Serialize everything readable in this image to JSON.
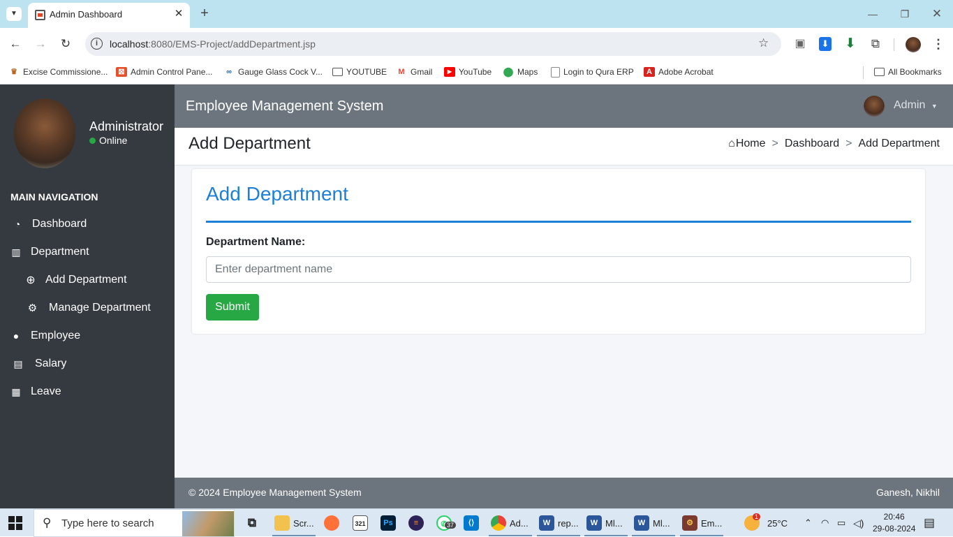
{
  "browser": {
    "tab_title": "Admin Dashboard",
    "url_host": "localhost",
    "url_path": ":8080/EMS-Project/addDepartment.jsp"
  },
  "bookmarks": {
    "items": [
      {
        "label": "Excise Commissione...",
        "icon": "emblem-icon",
        "color": "#b5651d"
      },
      {
        "label": "Admin Control Pane...",
        "icon": "admin-panel-icon",
        "color": "#e3522d"
      },
      {
        "label": "Gauge Glass Cock V...",
        "icon": "gauge-logo-icon",
        "color": "#1b5fbf"
      },
      {
        "label": "YOUTUBE",
        "icon": "folder-icon",
        "color": "#555555"
      },
      {
        "label": "Gmail",
        "icon": "gmail-icon",
        "color": "#ea4335"
      },
      {
        "label": "YouTube",
        "icon": "youtube-icon",
        "color": "#ff0000"
      },
      {
        "label": "Maps",
        "icon": "maps-pin-icon",
        "color": "#34a853"
      },
      {
        "label": "Login to Qura ERP",
        "icon": "page-icon",
        "color": "#777777"
      },
      {
        "label": "Adobe Acrobat",
        "icon": "acrobat-icon",
        "color": "#d8231f"
      }
    ],
    "all_bookmarks": "All Bookmarks"
  },
  "sidebar": {
    "user_name": "Administrator",
    "status": "Online",
    "nav_heading": "MAIN NAVIGATION",
    "items": [
      {
        "label": "Dashboard",
        "icon": "tachometer-icon"
      },
      {
        "label": "Department",
        "icon": "building-icon"
      },
      {
        "label": "Add Department",
        "icon": "plus-circle-icon"
      },
      {
        "label": "Manage Department",
        "icon": "cogs-icon"
      },
      {
        "label": "Employee",
        "icon": "user-icon"
      },
      {
        "label": "Salary",
        "icon": "money-card-icon"
      },
      {
        "label": "Leave",
        "icon": "calendar-icon"
      }
    ]
  },
  "topbar": {
    "brand": "Employee Management System",
    "user": "Admin"
  },
  "header": {
    "page_title": "Add Department",
    "breadcrumb": [
      "Home",
      "Dashboard",
      "Add Department"
    ]
  },
  "form": {
    "card_title": "Add Department",
    "field_label": "Department Name:",
    "placeholder": "Enter department name",
    "value": "",
    "submit_label": "Submit"
  },
  "footer": {
    "copyright": "© 2024 Employee Management System",
    "authors": "Ganesh, Nikhil"
  },
  "taskbar": {
    "search_placeholder": "Type here to search",
    "apps": [
      {
        "label": "Scr...",
        "icon": "file-explorer-icon",
        "color": "#f2c14e"
      },
      {
        "label": "",
        "icon": "firefox-icon",
        "color": "#ff7139"
      },
      {
        "label": "",
        "icon": "calendar-app-icon",
        "color": "#555555"
      },
      {
        "label": "",
        "icon": "photoshop-icon",
        "color": "#001e36"
      },
      {
        "label": "",
        "icon": "eclipse-icon",
        "color": "#2c2255"
      },
      {
        "label": "",
        "icon": "whatsapp-icon",
        "color": "#25d366",
        "badge": "37"
      },
      {
        "label": "",
        "icon": "vscode-icon",
        "color": "#007acc"
      },
      {
        "label": "Ad...",
        "icon": "chrome-icon",
        "color": "#4285f4"
      },
      {
        "label": "rep...",
        "icon": "word-icon",
        "color": "#2b579a"
      },
      {
        "label": "Ml...",
        "icon": "word-icon",
        "color": "#2b579a"
      },
      {
        "label": "Ml...",
        "icon": "word-icon",
        "color": "#2b579a"
      },
      {
        "label": "Em...",
        "icon": "ems-app-icon",
        "color": "#7a3b2e"
      }
    ],
    "weather_temp": "25°C",
    "weather_badge": "1",
    "time": "20:46",
    "date": "29-08-2024"
  }
}
